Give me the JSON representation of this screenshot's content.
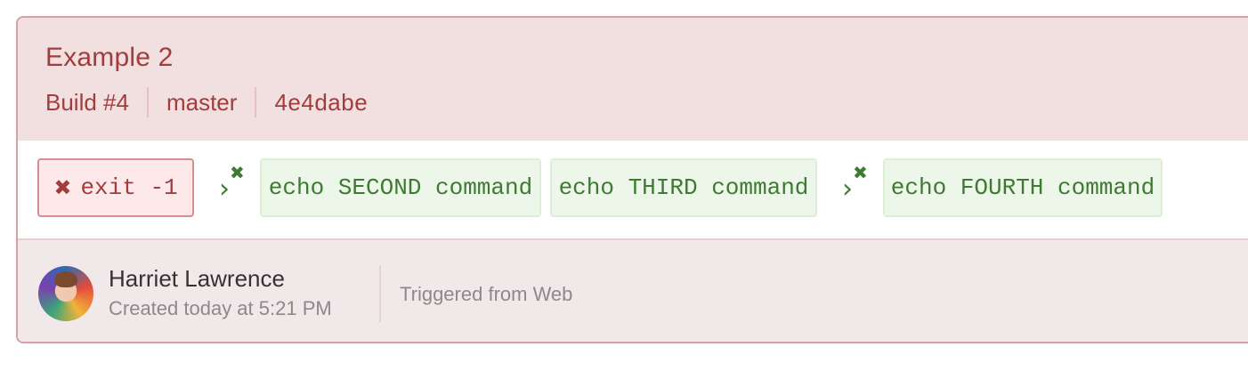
{
  "build": {
    "title": "Example 2",
    "number_label": "Build #4",
    "branch": "master",
    "commit": "4e4dabe"
  },
  "jobs": {
    "failed": {
      "label": "exit -1",
      "icon": "x-icon"
    },
    "second": "echo SECOND command",
    "third": "echo THIRD command",
    "fourth": "echo FOURTH command"
  },
  "footer": {
    "user_name": "Harriet Lawrence",
    "created": "Created today at 5:21 PM",
    "trigger": "Triggered from Web"
  },
  "colors": {
    "failed": "#a33d3d",
    "passed": "#3f7a34",
    "header_bg": "#f2dfe0",
    "border": "#d8a0a6"
  }
}
